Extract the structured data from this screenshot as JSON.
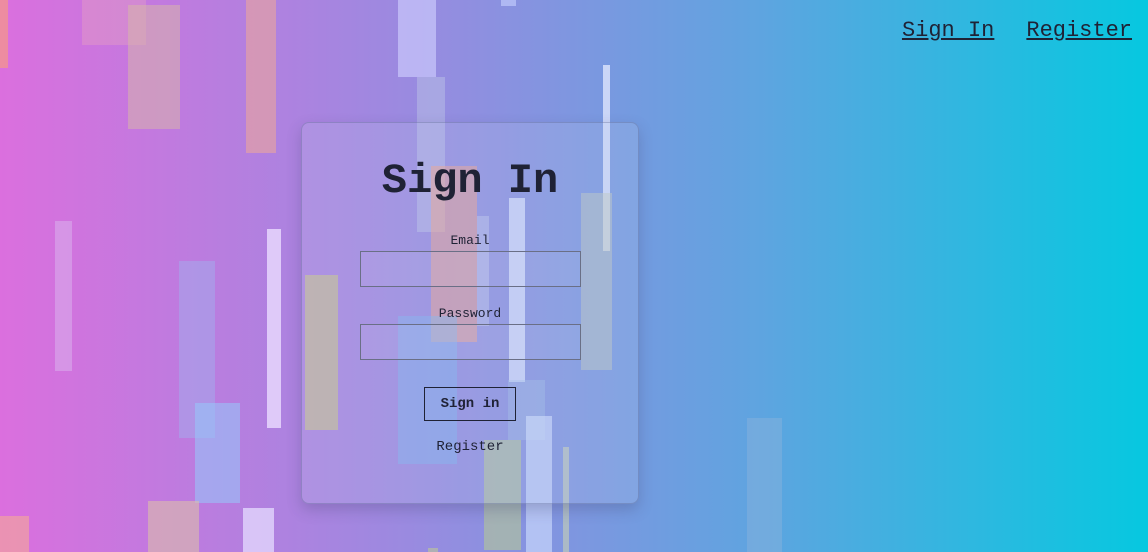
{
  "nav": {
    "sign_in": "Sign In",
    "register": "Register"
  },
  "form": {
    "title": "Sign In",
    "email_label": "Email",
    "email_value": "",
    "password_label": "Password",
    "password_value": "",
    "submit_label": "Sign in",
    "register_link": "Register"
  },
  "colors": {
    "gradient_start": "#db6fde",
    "gradient_end": "#06c8e0",
    "text": "#1f2235"
  }
}
